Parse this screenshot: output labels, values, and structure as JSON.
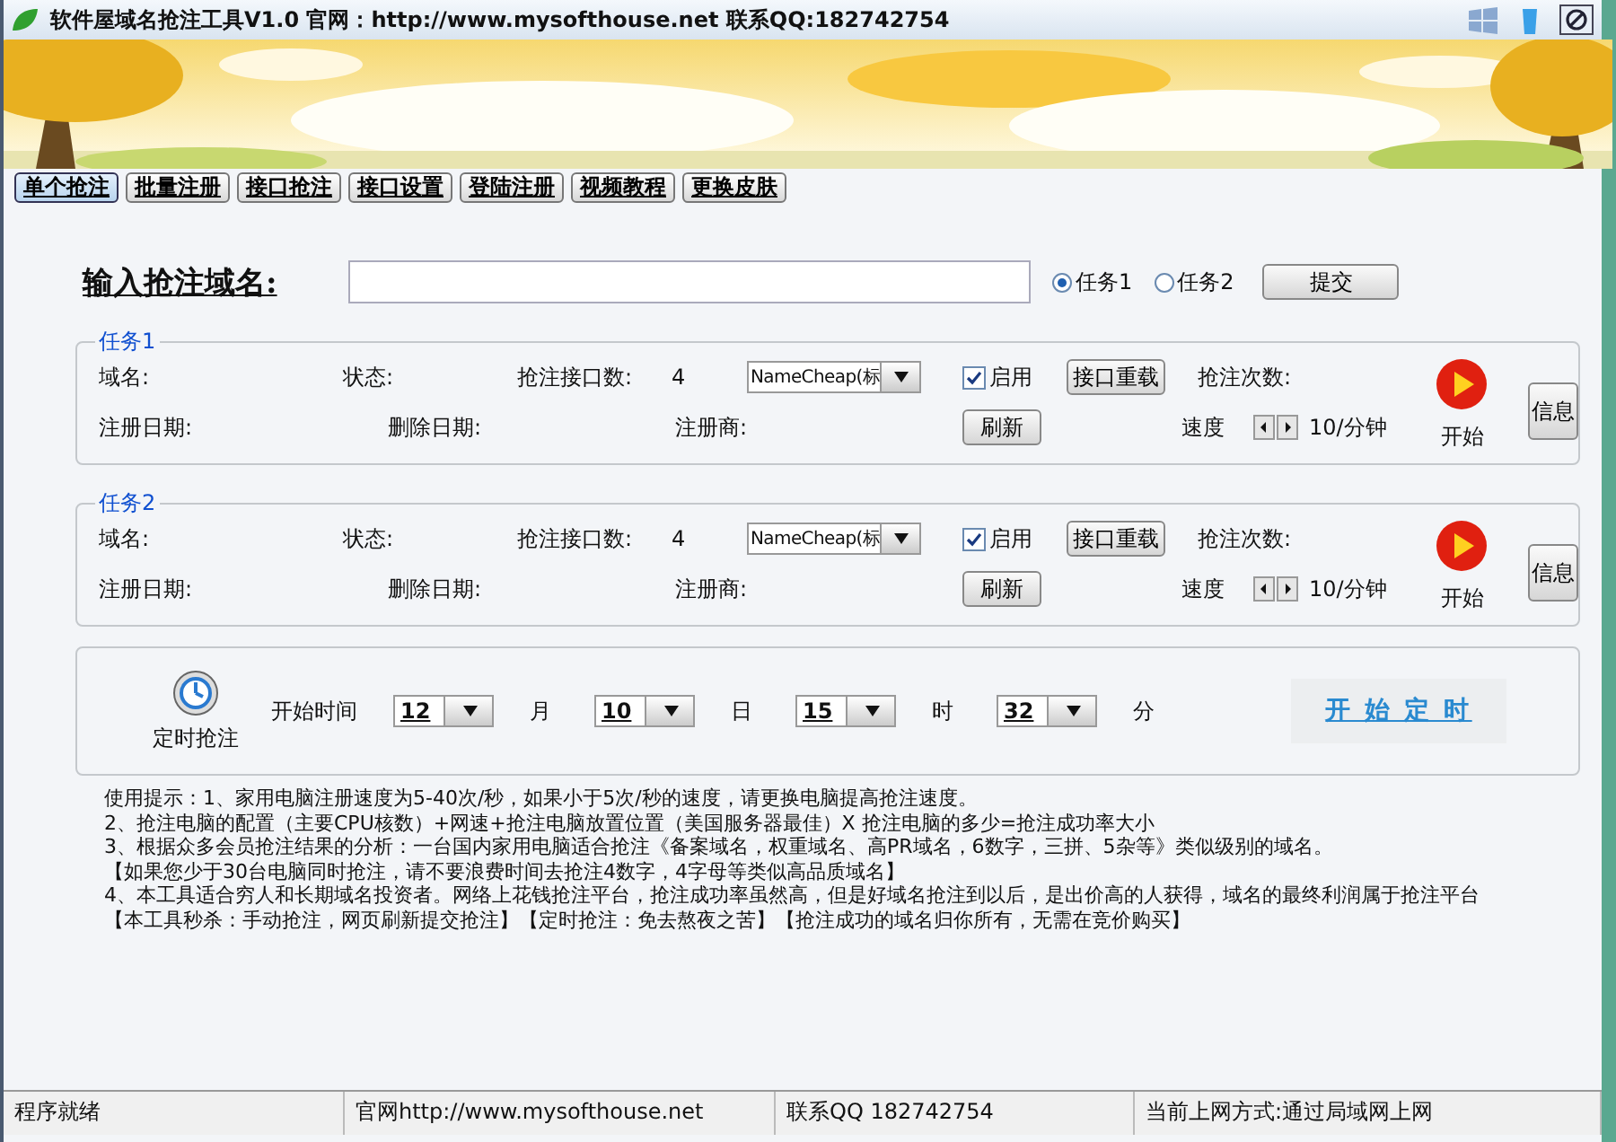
{
  "window": {
    "title": "软件屋域名抢注工具V1.0 官网：http://www.mysofthouse.net 联系QQ:182742754"
  },
  "tabs": [
    {
      "label": "单个抢注",
      "selected": true
    },
    {
      "label": "批量注册",
      "selected": false
    },
    {
      "label": "接口抢注",
      "selected": false
    },
    {
      "label": "接口设置",
      "selected": false
    },
    {
      "label": "登陆注册",
      "selected": false
    },
    {
      "label": "视频教程",
      "selected": false
    },
    {
      "label": "更换皮肤",
      "selected": false
    }
  ],
  "domain_entry": {
    "label": "输入抢注域名:"
  },
  "task_choice": [
    {
      "label": "任务1",
      "selected": true
    },
    {
      "label": "任务2",
      "selected": false
    }
  ],
  "submit_button": "提交",
  "tasks": [
    {
      "title": "任务1",
      "domain_label": "域名:",
      "status_label": "状态:",
      "port_count_label": "抢注接口数:",
      "port_count": "4",
      "provider": "NameCheap(标",
      "enabled": {
        "label": "启用",
        "checked": true
      },
      "reload_button": "接口重载",
      "attempts_label": "抢注次数:",
      "reg_date_label": "注册日期:",
      "delete_date_label": "删除日期:",
      "registrar_label": "注册商:",
      "refresh_button": "刷新",
      "speed_label": "速度",
      "speed_value": "10/分钟",
      "start_label": "开始",
      "info_button": "信息"
    },
    {
      "title": "任务2",
      "domain_label": "域名:",
      "status_label": "状态:",
      "port_count_label": "抢注接口数:",
      "port_count": "4",
      "provider": "NameCheap(标",
      "enabled": {
        "label": "启用",
        "checked": true
      },
      "reload_button": "接口重载",
      "attempts_label": "抢注次数:",
      "reg_date_label": "注册日期:",
      "delete_date_label": "删除日期:",
      "registrar_label": "注册商:",
      "refresh_button": "刷新",
      "speed_label": "速度",
      "speed_value": "10/分钟",
      "start_label": "开始",
      "info_button": "信息"
    }
  ],
  "timer": {
    "label": "定时抢注",
    "start_time_label": "开始时间",
    "selects": [
      {
        "value": "12",
        "unit": "月"
      },
      {
        "value": "10",
        "unit": "日"
      },
      {
        "value": "15",
        "unit": "时"
      },
      {
        "value": "32",
        "unit": "分"
      }
    ],
    "start_button": "开 始 定 时"
  },
  "tips": [
    "使用提示：1、家用电脑注册速度为5-40次/秒，如果小于5次/秒的速度，请更换电脑提高抢注速度。",
    "2、抢注电脑的配置（主要CPU核数）+网速+抢注电脑放置位置（美国服务器最佳）X 抢注电脑的多少=抢注成功率大小",
    "3、根据众多会员抢注结果的分析：一台国内家用电脑适合抢注《备案域名，权重域名、高PR域名，6数字，三拼、5杂等》类似级别的域名。",
    "【如果您少于30台电脑同时抢注，请不要浪费时间去抢注4数字，4字母等类似高品质域名】",
    "4、本工具适合穷人和长期域名投资者。网络上花钱抢注平台，抢注成功率虽然高，但是好域名抢注到以后，是出价高的人获得，域名的最终利润属于抢注平台",
    "【本工具秒杀：手动抢注，网页刷新提交抢注】【定时抢注：免去熬夜之苦】【抢注成功的域名归你所有，无需在竞价购买】"
  ],
  "status_bar": [
    "程序就绪",
    "官网http://www.mysofthouse.net",
    "联系QQ 182742754",
    "当前上网方式:通过局域网上网"
  ]
}
